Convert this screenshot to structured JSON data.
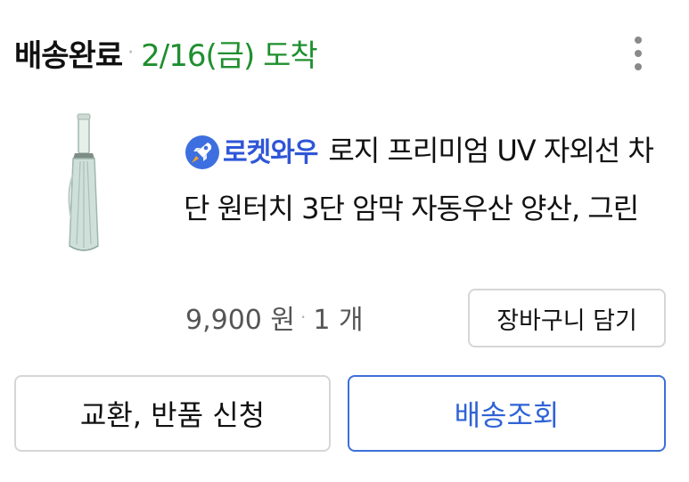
{
  "order": {
    "status": "배송완료",
    "separator": "·",
    "arrival": "2/16(금) 도착",
    "more_icon": "more-vertical-icon"
  },
  "product": {
    "image_icon": "umbrella-product-image",
    "badge": {
      "icon": "rocket-icon",
      "label": "로켓와우",
      "color": "#2f56d6"
    },
    "title": "로지 프리미엄 UV 자외선 차단 원터치 3단 암막 자동우산 양산, 그린",
    "price": "9,900 원",
    "separator": "·",
    "quantity": "1 개",
    "cart_button": "장바구니 담기"
  },
  "actions": {
    "exchange_return": "교환, 반품 신청",
    "track_delivery": "배송조회"
  },
  "colors": {
    "arrival_green": "#1f8f2f",
    "accent_blue": "#2f63d6",
    "border_gray": "#d6d6d6"
  }
}
